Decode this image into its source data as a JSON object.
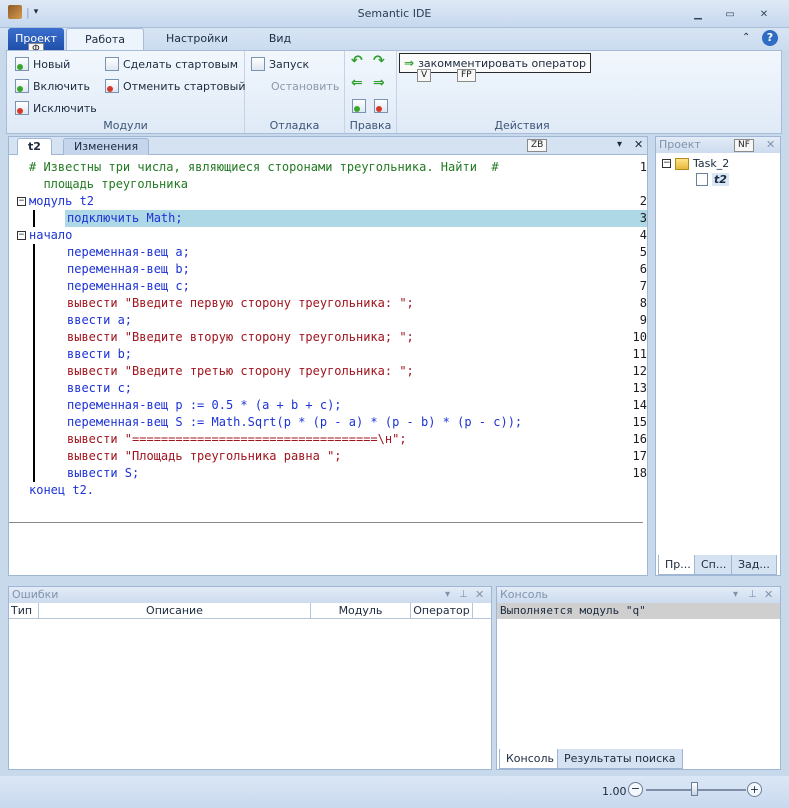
{
  "window": {
    "title": "Semantic IDE"
  },
  "ribbon": {
    "tabs": [
      "Проект",
      "Работа",
      "Настройки",
      "Вид"
    ],
    "keytips": {
      "file": "Ф",
      "v": "V",
      "fp": "FP"
    },
    "modules": {
      "label": "Модули",
      "new": "Новый",
      "include": "Включить",
      "exclude": "Исключить",
      "make_start": "Сделать стартовым",
      "cancel_start": "Отменить стартовый"
    },
    "debug": {
      "label": "Отладка",
      "run": "Запуск",
      "stop": "Остановить"
    },
    "edit": {
      "label": "Правка"
    },
    "actions": {
      "label": "Действия",
      "comment": "закомментировать оператор"
    }
  },
  "editor": {
    "tabs": [
      "t2",
      "Изменения"
    ],
    "zb": "ZB",
    "lines": [
      {
        "text": "# Известны три числа, являющиеся сторонами треугольника. Найти  #",
        "num": "1"
      },
      {
        "text": "  площадь треугольника",
        "num": ""
      },
      {
        "text": "модуль t2",
        "num": "2"
      },
      {
        "text": "подключить Math;",
        "num": "3"
      },
      {
        "text": "начало",
        "num": "4"
      },
      {
        "text": "переменная-вещ a;",
        "num": "5"
      },
      {
        "text": "переменная-вещ b;",
        "num": "6"
      },
      {
        "text": "переменная-вещ c;",
        "num": "7"
      },
      {
        "text": "вывести \"Введите первую сторону треугольника: \";",
        "num": "8"
      },
      {
        "text": "ввести a;",
        "num": "9"
      },
      {
        "text": "вывести \"Введите вторую сторону треугольника; \";",
        "num": "10"
      },
      {
        "text": "ввести b;",
        "num": "11"
      },
      {
        "text": "вывести \"Введите третью сторону треугольника: \";",
        "num": "12"
      },
      {
        "text": "ввести c;",
        "num": "13"
      },
      {
        "text": "переменная-вещ p := 0.5 * (a + b + c);",
        "num": "14"
      },
      {
        "text": "переменная-вещ S := Math.Sqrt(p * (p - a) * (p - b) * (p - c));",
        "num": "15"
      },
      {
        "text": "вывести \"==================================\\н\";",
        "num": "16"
      },
      {
        "text": "вывести \"Площадь треугольника равна \";",
        "num": "17"
      },
      {
        "text": "вывести S;",
        "num": "18"
      },
      {
        "text": "конец t2.",
        "num": ""
      }
    ]
  },
  "project_panel": {
    "title": "Проект",
    "nf": "NF",
    "root": "Task_2",
    "child": "t2",
    "tabs": [
      "Пр...",
      "Сп...",
      "Зад..."
    ]
  },
  "errors_panel": {
    "title": "Ошибки",
    "columns": [
      "Тип",
      "Описание",
      "Модуль",
      "Оператор"
    ]
  },
  "console_panel": {
    "title": "Консоль",
    "row": "Выполняется модуль \"q\"",
    "tabs": [
      "Консоль",
      "Результаты поиска"
    ]
  },
  "status": {
    "zoom": "1.00"
  }
}
